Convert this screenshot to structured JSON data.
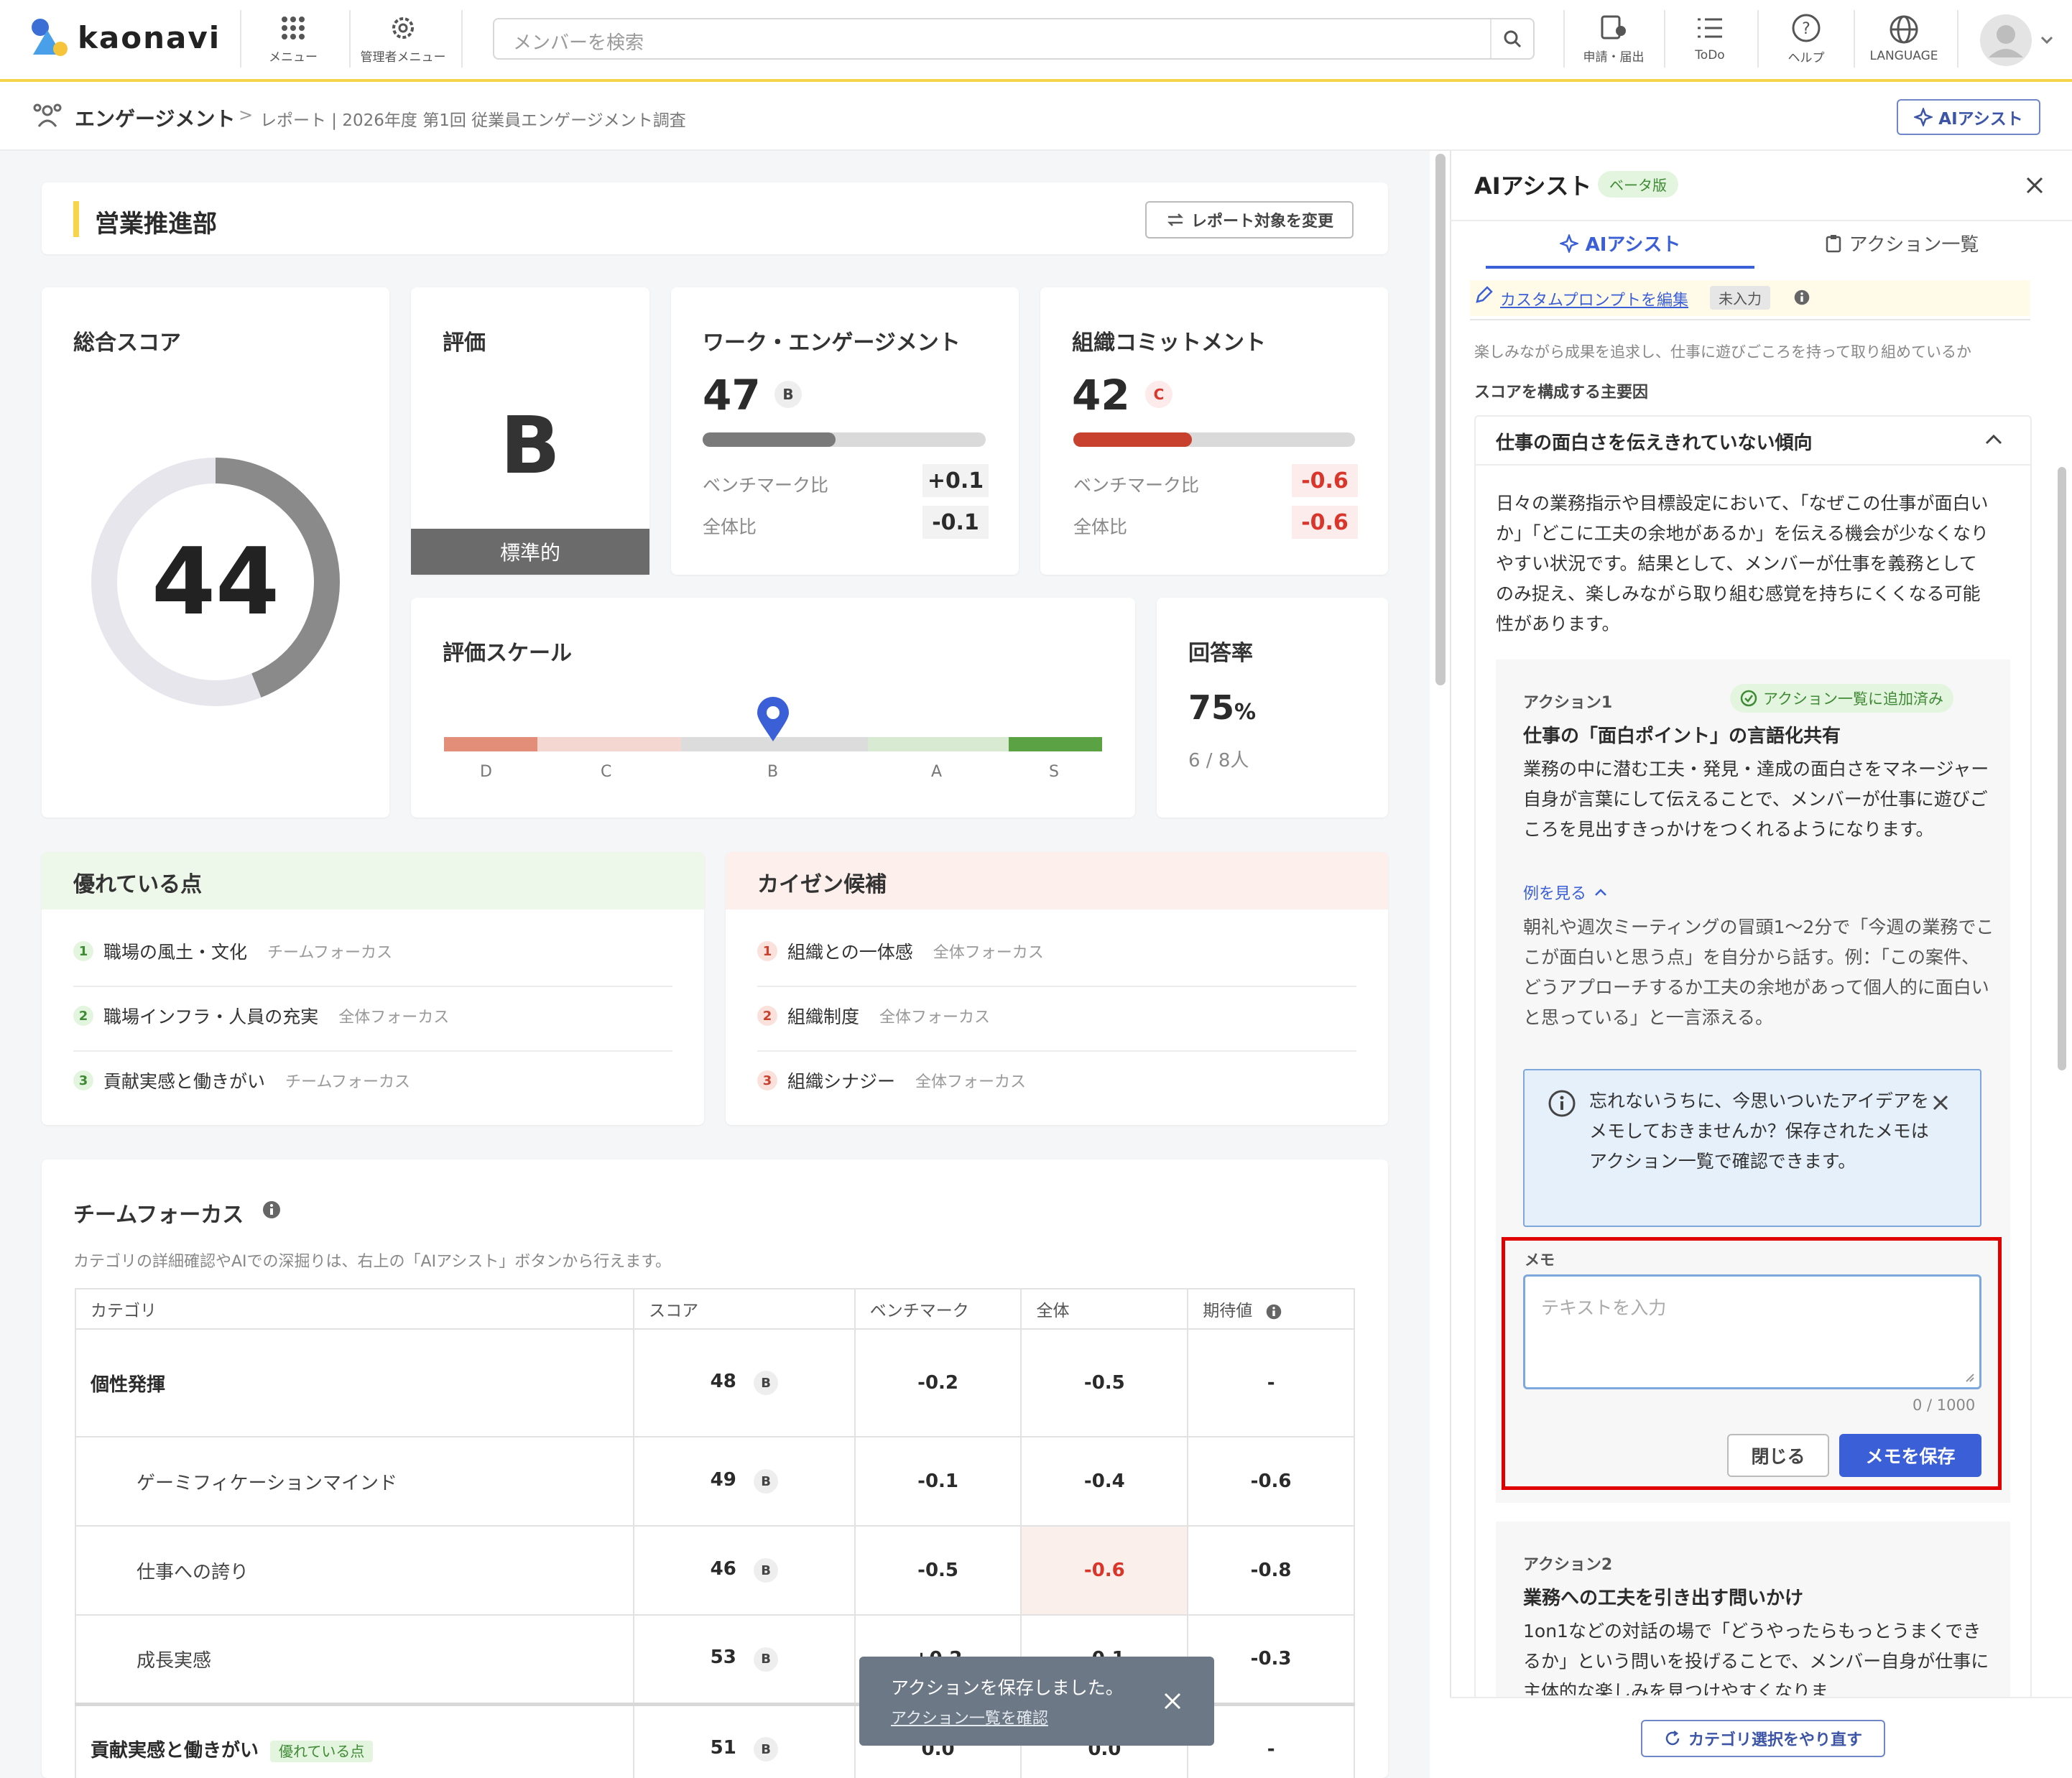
{
  "header": {
    "logo_text": "kaonavi",
    "menu_label": "メニュー",
    "admin_menu_label": "管理者メニュー",
    "search_placeholder": "メンバーを検索",
    "request_label": "申請・届出",
    "todo_label": "ToDo",
    "help_label": "ヘルプ",
    "language_label": "LANGUAGE"
  },
  "breadcrumb": {
    "section": "エンゲージメント",
    "separator": ">",
    "path": "レポート | 2026年度 第1回 従業員エンゲージメント調査",
    "ai_button": "AIアシスト"
  },
  "main": {
    "department": "営業推進部",
    "change_target_button": "レポート対象を変更",
    "total_score": {
      "title": "総合スコア",
      "value": "44",
      "fill_fraction": 0.44
    },
    "rating": {
      "title": "評価",
      "grade": "B",
      "label": "標準的"
    },
    "work_engagement": {
      "title": "ワーク・エンゲージメント",
      "score": "47",
      "grade": "B",
      "bar_fraction": 0.47,
      "bench_label": "ベンチマーク比",
      "bench_value": "+0.1",
      "overall_label": "全体比",
      "overall_value": "-0.1"
    },
    "org_commitment": {
      "title": "組織コミットメント",
      "score": "42",
      "grade": "C",
      "bar_fraction": 0.42,
      "bench_label": "ベンチマーク比",
      "bench_value": "-0.6",
      "overall_label": "全体比",
      "overall_value": "-0.6"
    },
    "scale": {
      "title": "評価スケール",
      "labels": [
        "D",
        "C",
        "B",
        "A",
        "S"
      ],
      "marker_fraction": 0.5
    },
    "response": {
      "title": "回答率",
      "value": "75",
      "unit": "%",
      "count": "6 / 8人"
    },
    "strengths": {
      "title": "優れている点",
      "items": [
        {
          "no": "1",
          "label": "職場の風土・文化",
          "tag": "チームフォーカス"
        },
        {
          "no": "2",
          "label": "職場インフラ・人員の充実",
          "tag": "全体フォーカス"
        },
        {
          "no": "3",
          "label": "貢献実感と働きがい",
          "tag": "チームフォーカス"
        }
      ]
    },
    "improvements": {
      "title": "カイゼン候補",
      "items": [
        {
          "no": "1",
          "label": "組織との一体感",
          "tag": "全体フォーカス"
        },
        {
          "no": "2",
          "label": "組織制度",
          "tag": "全体フォーカス"
        },
        {
          "no": "3",
          "label": "組織シナジー",
          "tag": "全体フォーカス"
        }
      ]
    },
    "team_focus": {
      "title": "チームフォーカス",
      "desc": "カテゴリの詳細確認やAIでの深掘りは、右上の「AIアシスト」ボタンから行えます。",
      "headers": [
        "カテゴリ",
        "スコア",
        "ベンチマーク",
        "全体",
        "期待値"
      ],
      "rows": [
        {
          "cat": "個性発揮",
          "score": "48",
          "grade": "B",
          "bench": "-0.2",
          "overall": "-0.5",
          "expect": "-"
        },
        {
          "cat": "ゲーミフィケーションマインド",
          "score": "49",
          "grade": "B",
          "bench": "-0.1",
          "overall": "-0.4",
          "expect": "-0.6"
        },
        {
          "cat": "仕事への誇り",
          "score": "46",
          "grade": "B",
          "bench": "-0.5",
          "overall": "-0.6",
          "expect": "-0.8"
        },
        {
          "cat": "成長実感",
          "score": "53",
          "grade": "B",
          "bench": "+0.2",
          "overall": "-0.1",
          "expect": "-0.3"
        },
        {
          "cat": "貢献実感と働きがい",
          "tag": "優れている点",
          "score": "51",
          "grade": "B",
          "bench": "0.0",
          "overall": "0.0",
          "expect": "-"
        }
      ]
    },
    "toast": {
      "message": "アクションを保存しました。",
      "link": "アクション一覧を確認"
    }
  },
  "panel": {
    "title": "AIアシスト",
    "beta": "ベータ版",
    "tab_ai": "AIアシスト",
    "tab_actions": "アクション一覧",
    "edit_prompt": "カスタムプロンプトを編集",
    "unset": "未入力",
    "intro": "楽しみながら成果を追求し、仕事に遊びごころを持って取り組めているか",
    "factors_heading": "スコアを構成する主要因",
    "accordion_title": "仕事の面白さを伝えきれていない傾向",
    "accordion_body": "日々の業務指示や目標設定において、「なぜこの仕事が面白いか」「どこに工夫の余地があるか」を伝える機会が少なくなりやすい状況です。結果として、メンバーが仕事を義務としてのみ捉え、楽しみながら取り組む感覚を持ちにくくなる可能性があります。",
    "action1": {
      "label": "アクション1",
      "added": "アクション一覧に追加済み",
      "title": "仕事の「面白ポイント」の言語化共有",
      "body": "業務の中に潜む工夫・発見・達成の面白さをマネージャー自身が言葉にして伝えることで、メンバーが仕事に遊びごころを見出すきっかけをつくれるようになります。",
      "example_link": "例を見る",
      "example": "朝礼や週次ミーティングの冒頭1〜2分で「今週の業務でここが面白いと思う点」を自分から話す。例：「この案件、どうアプローチするか工夫の余地があって個人的に面白いと思っている」と一言添える。"
    },
    "info": "忘れないうちに、今思いついたアイデアをメモしておきませんか？保存されたメモはアクション一覧で確認できます。",
    "memo_label": "メモ",
    "memo_placeholder": "テキストを入力",
    "memo_count": "0 / 1000",
    "close_button": "閉じる",
    "save_button": "メモを保存",
    "action2": {
      "label": "アクション2",
      "title": "業務への工夫を引き出す問いかけ",
      "body": "1on1などの対話の場で「どうやったらもっとうまくできるか」という問いを投げることで、メンバー自身が仕事に主体的な楽しみを見つけやすくなりま"
    },
    "reselect_button": "カテゴリ選択をやり直す"
  },
  "colors": {
    "accent": "#f7d54a",
    "primary": "#3b5fd6",
    "danger": "#d9352b",
    "highlight": "#e00000"
  }
}
